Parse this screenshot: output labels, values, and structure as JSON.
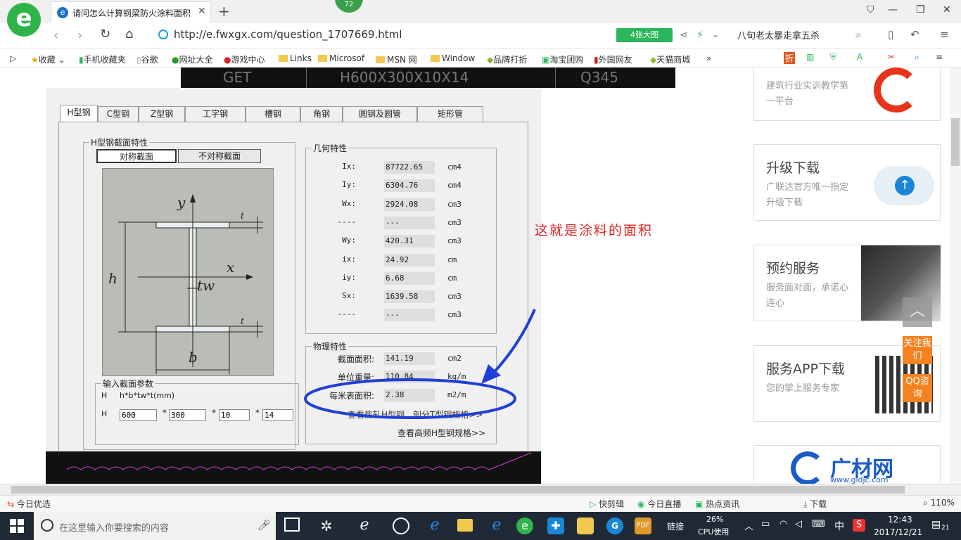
{
  "browser": {
    "badge_count": "72",
    "tab_title": "请问怎么计算钢梁防火涂料面积",
    "tab_close": "✕",
    "new_tab": "+",
    "url": "http://e.fwxgx.com/question_1707669.html",
    "big_image_label": "4张大图",
    "search_text": "八旬老太暴走拿五杀",
    "logo_char": "e"
  },
  "bookmarks": {
    "favorites": "收藏",
    "items": [
      "手机收藏夹",
      "谷歌",
      "网址大全",
      "游戏中心",
      "Links",
      "Microsof",
      "MSN 网",
      "Window",
      "品牌打折",
      "淘宝团购",
      "外国网友",
      "天猫商城"
    ],
    "more": "»"
  },
  "header_bar": {
    "cells": [
      "GET",
      "H600X300X10X14",
      "Q345"
    ]
  },
  "app": {
    "tabs": [
      "H型钢",
      "C型钢",
      "Z型钢",
      "工字钢",
      "槽钢",
      "角钢",
      "圆钢及圆管",
      "矩形管"
    ],
    "section_group_label": "H型钢截面特性",
    "btn_sym": "对称截面",
    "btn_asym": "不对称截面",
    "diagram_labels": {
      "y": "y",
      "x": "x",
      "h": "h",
      "b": "b",
      "tw": "tw",
      "t_top": "t",
      "t_bot": "t"
    },
    "geo_label": "几何特性",
    "geo_rows": [
      {
        "label": "Ix:",
        "value": "87722.65",
        "unit": "cm4"
      },
      {
        "label": "Iy:",
        "value": "6304.76",
        "unit": "cm4"
      },
      {
        "label": "Wx:",
        "value": "2924.08",
        "unit": "cm3"
      },
      {
        "label": "----",
        "value": "---",
        "unit": "cm3"
      },
      {
        "label": "Wy:",
        "value": "420.31",
        "unit": "cm3"
      },
      {
        "label": "ix:",
        "value": "24.92",
        "unit": "cm"
      },
      {
        "label": "iy:",
        "value": "6.68",
        "unit": "cm"
      },
      {
        "label": "Sx:",
        "value": "1639.58",
        "unit": "cm3"
      },
      {
        "label": "----",
        "value": "---",
        "unit": "cm3"
      }
    ],
    "phys_label": "物理特性",
    "phys_rows": [
      {
        "label": "截面面积:",
        "value": "141.19",
        "unit": "cm2"
      },
      {
        "label": "单位重量:",
        "value": "110.84",
        "unit": "kg/m"
      },
      {
        "label": "每米表面积:",
        "value": "2.38",
        "unit": "m2/m"
      }
    ],
    "link_hot": "查看热轧H型钢、剖分T型钢规格>>",
    "link_high": "查看高频H型钢规格>>",
    "input_label": "输入截面参数",
    "input_h": "H",
    "input_formula": "h*b*tw*t(mm)",
    "input_row_label": "H",
    "star": "*",
    "inputs": [
      "600",
      "300",
      "10",
      "14"
    ]
  },
  "annotation": "这就是涂料的面积",
  "sidebar": {
    "cards": [
      {
        "title": "",
        "sub": "建筑行业实训教学第一平台"
      },
      {
        "title": "升级下载",
        "sub": "广联达官方唯一指定升级下载"
      },
      {
        "title": "预约服务",
        "sub": "服务面对面，承诺心连心"
      },
      {
        "title": "服务APP下载",
        "sub": "您的掌上服务专家"
      },
      {
        "title": "广材网",
        "sub": "www.gldjc.com"
      }
    ],
    "follow": "关注我们",
    "qq": "QQ咨询"
  },
  "status": {
    "left": "今日优选",
    "items": [
      "快剪辑",
      "今日直播",
      "热点资讯",
      "下载"
    ],
    "zoom": "110%"
  },
  "taskbar": {
    "search_placeholder": "在这里输入你要搜索的内容",
    "links": "链接",
    "cpu_pct": "26%",
    "cpu_label": "CPU使用",
    "ime": "中",
    "time": "12:43",
    "date": "2017/12/21",
    "notif": "21"
  },
  "colors": {
    "accent_green": "#2fb44a",
    "annotation_red": "#e0231f",
    "ellipse_blue": "#1e3fd8",
    "orange": "#f58220"
  }
}
